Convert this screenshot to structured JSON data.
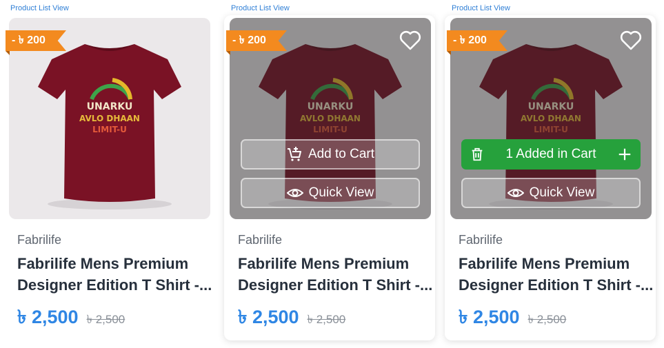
{
  "colors": {
    "link_blue": "#2f7fd6",
    "price_blue": "#2f86e4",
    "badge_orange": "#f38a1f",
    "added_green": "#26a13c",
    "shirt_maroon": "#7a1225",
    "title_text": "#27303c",
    "brand_text": "#5f6670"
  },
  "cards": [
    {
      "view_label": "Product List View",
      "discount": "- ৳ 200",
      "print_line1": "UNARKU",
      "print_line2": "AVLO DHAAN",
      "print_line3": "LIMIT-U",
      "brand": "Fabrilife",
      "title_line1": "Fabrilife Mens Premium",
      "title_line2": "Designer Edition T Shirt -...",
      "price": "৳ 2,500",
      "old_price": "৳ 2,500",
      "state": "default"
    },
    {
      "view_label": "Product List View",
      "discount": "- ৳ 200",
      "print_line1": "UNARKU",
      "print_line2": "AVLO DHAAN",
      "print_line3": "LIMIT-U",
      "brand": "Fabrilife",
      "title_line1": "Fabrilife Mens Premium",
      "title_line2": "Designer Edition T Shirt -...",
      "price": "৳ 2,500",
      "old_price": "৳ 2,500",
      "state": "hover",
      "add_to_cart_label": "Add to Cart",
      "quick_view_label": "Quick View",
      "wishlist_icon": "heart-icon"
    },
    {
      "view_label": "Product List View",
      "discount": "- ৳ 200",
      "print_line1": "UNARKU",
      "print_line2": "AVLO DHAAN",
      "print_line3": "LIMIT-U",
      "brand": "Fabrilife",
      "title_line1": "Fabrilife Mens Premium",
      "title_line2": "Designer Edition T Shirt -...",
      "price": "৳ 2,500",
      "old_price": "৳ 2,500",
      "state": "added",
      "added_label": "1 Added in Cart",
      "quick_view_label": "Quick View",
      "wishlist_icon": "heart-icon",
      "remove_icon": "trash-icon",
      "increment_icon": "plus-icon"
    }
  ]
}
